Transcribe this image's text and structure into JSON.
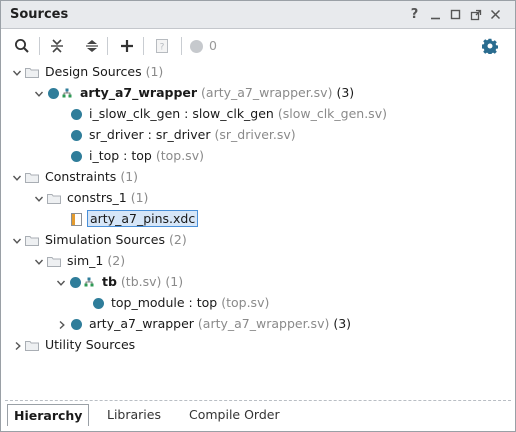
{
  "window": {
    "title": "Sources",
    "help_label": "?"
  },
  "toolbar": {
    "search_icon": "search-icon",
    "collapse_all_icon": "collapse-all-icon",
    "expand_all_icon": "expand-all-icon",
    "add_icon": "add-icon",
    "properties_icon": "properties-icon",
    "status_count": "0",
    "settings_icon": "gear-icon"
  },
  "tree": {
    "design_sources": {
      "label": "Design Sources",
      "count": "(1)"
    },
    "top_wrapper": {
      "label": "arty_a7_wrapper",
      "file": "(arty_a7_wrapper.sv)",
      "count": "(3)"
    },
    "clk_gen": {
      "label": "i_slow_clk_gen : slow_clk_gen",
      "file": "(slow_clk_gen.sv)"
    },
    "sr_driver": {
      "label": "sr_driver : sr_driver",
      "file": "(sr_driver.sv)"
    },
    "i_top": {
      "label": "i_top : top",
      "file": "(top.sv)"
    },
    "constraints": {
      "label": "Constraints",
      "count": "(1)"
    },
    "constrs_1": {
      "label": "constrs_1",
      "count": "(1)"
    },
    "pins_xdc": {
      "label": "arty_a7_pins.xdc"
    },
    "sim_sources": {
      "label": "Simulation Sources",
      "count": "(2)"
    },
    "sim_1": {
      "label": "sim_1",
      "count": "(2)"
    },
    "tb": {
      "label": "tb",
      "file": "(tb.sv)",
      "count": "(1)"
    },
    "top_module": {
      "label": "top_module : top",
      "file": "(top.sv)"
    },
    "sim_wrapper": {
      "label": "arty_a7_wrapper",
      "file": "(arty_a7_wrapper.sv)",
      "count": "(3)"
    },
    "utility_sources": {
      "label": "Utility Sources"
    }
  },
  "tabs": {
    "hierarchy": "Hierarchy",
    "libraries": "Libraries",
    "compile_order": "Compile Order"
  },
  "colors": {
    "module_dot": "#2f7d9a",
    "selection": "#d6e6f8",
    "folder": "#c7cbd1"
  }
}
